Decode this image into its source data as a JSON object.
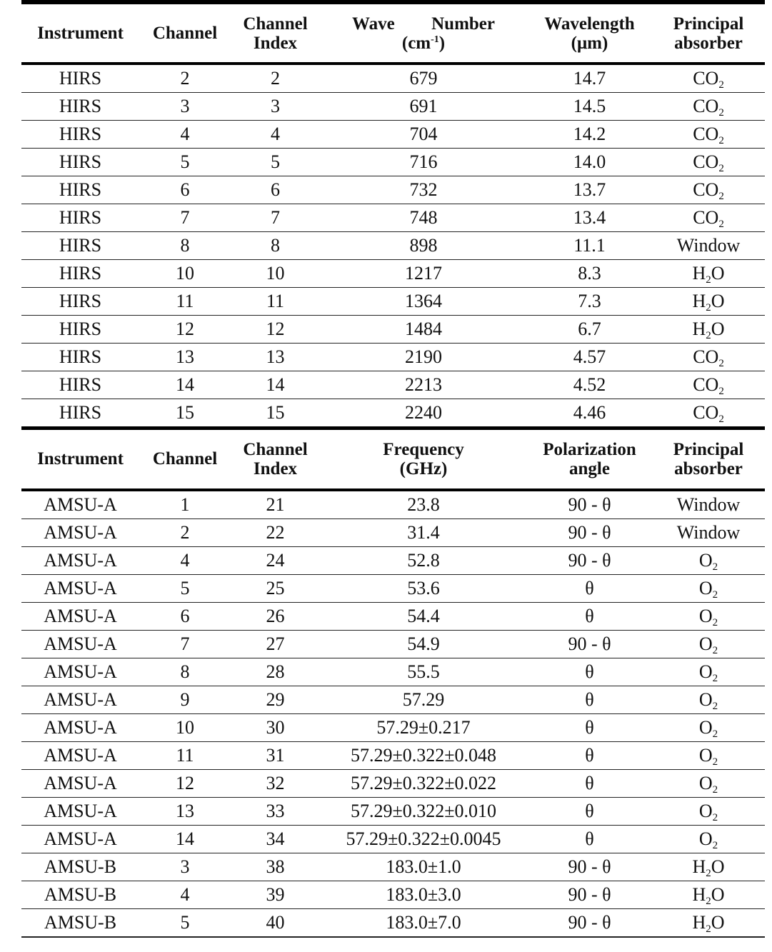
{
  "table1": {
    "headers": {
      "instrument": "Instrument",
      "channel": "Channel",
      "channel_index_1": "Channel",
      "channel_index_2": "Index",
      "wave_number_1a": "Wave",
      "wave_number_1b": "Number",
      "wave_number_2": "(cm",
      "wave_number_sup": "-1",
      "wave_number_3": ")",
      "wavelength_1": "Wavelength",
      "wavelength_2": "(μm)",
      "absorber_1": "Principal",
      "absorber_2": "absorber"
    },
    "rows": [
      {
        "instrument": "HIRS",
        "channel": "2",
        "index": "2",
        "value": "679",
        "wavelength": "14.7",
        "absorber": "CO",
        "sub": "2",
        "tail": ""
      },
      {
        "instrument": "HIRS",
        "channel": "3",
        "index": "3",
        "value": "691",
        "wavelength": "14.5",
        "absorber": "CO",
        "sub": "2",
        "tail": ""
      },
      {
        "instrument": "HIRS",
        "channel": "4",
        "index": "4",
        "value": "704",
        "wavelength": "14.2",
        "absorber": "CO",
        "sub": "2",
        "tail": ""
      },
      {
        "instrument": "HIRS",
        "channel": "5",
        "index": "5",
        "value": "716",
        "wavelength": "14.0",
        "absorber": "CO",
        "sub": "2",
        "tail": ""
      },
      {
        "instrument": "HIRS",
        "channel": "6",
        "index": "6",
        "value": "732",
        "wavelength": "13.7",
        "absorber": "CO",
        "sub": "2",
        "tail": ""
      },
      {
        "instrument": "HIRS",
        "channel": "7",
        "index": "7",
        "value": "748",
        "wavelength": "13.4",
        "absorber": "CO",
        "sub": "2",
        "tail": ""
      },
      {
        "instrument": "HIRS",
        "channel": "8",
        "index": "8",
        "value": "898",
        "wavelength": "11.1",
        "absorber": "Window",
        "sub": "",
        "tail": ""
      },
      {
        "instrument": "HIRS",
        "channel": "10",
        "index": "10",
        "value": "1217",
        "wavelength": "8.3",
        "absorber": "H",
        "sub": "2",
        "tail": "O"
      },
      {
        "instrument": "HIRS",
        "channel": "11",
        "index": "11",
        "value": "1364",
        "wavelength": "7.3",
        "absorber": "H",
        "sub": "2",
        "tail": "O"
      },
      {
        "instrument": "HIRS",
        "channel": "12",
        "index": "12",
        "value": "1484",
        "wavelength": "6.7",
        "absorber": "H",
        "sub": "2",
        "tail": "O"
      },
      {
        "instrument": "HIRS",
        "channel": "13",
        "index": "13",
        "value": "2190",
        "wavelength": "4.57",
        "absorber": "CO",
        "sub": "2",
        "tail": ""
      },
      {
        "instrument": "HIRS",
        "channel": "14",
        "index": "14",
        "value": "2213",
        "wavelength": "4.52",
        "absorber": "CO",
        "sub": "2",
        "tail": ""
      },
      {
        "instrument": "HIRS",
        "channel": "15",
        "index": "15",
        "value": "2240",
        "wavelength": "4.46",
        "absorber": "CO",
        "sub": "2",
        "tail": ""
      }
    ]
  },
  "table2": {
    "headers": {
      "instrument": "Instrument",
      "channel": "Channel",
      "channel_index_1": "Channel",
      "channel_index_2": "Index",
      "frequency_1": "Frequency",
      "frequency_2": "(GHz)",
      "polarization_1": "Polarization",
      "polarization_2": "angle",
      "absorber_1": "Principal",
      "absorber_2": "absorber"
    },
    "rows": [
      {
        "instrument": "AMSU-A",
        "channel": "1",
        "index": "21",
        "value": "23.8",
        "polarization": "90  -  θ",
        "absorber": "Window",
        "sub": "",
        "tail": ""
      },
      {
        "instrument": "AMSU-A",
        "channel": "2",
        "index": "22",
        "value": "31.4",
        "polarization": "90  -  θ",
        "absorber": "Window",
        "sub": "",
        "tail": ""
      },
      {
        "instrument": "AMSU-A",
        "channel": "4",
        "index": "24",
        "value": "52.8",
        "polarization": "90  -  θ",
        "absorber": "O",
        "sub": "2",
        "tail": ""
      },
      {
        "instrument": "AMSU-A",
        "channel": "5",
        "index": "25",
        "value": "53.6",
        "polarization": "θ",
        "absorber": "O",
        "sub": "2",
        "tail": ""
      },
      {
        "instrument": "AMSU-A",
        "channel": "6",
        "index": "26",
        "value": "54.4",
        "polarization": "θ",
        "absorber": "O",
        "sub": "2",
        "tail": ""
      },
      {
        "instrument": "AMSU-A",
        "channel": "7",
        "index": "27",
        "value": "54.9",
        "polarization": "90  -  θ",
        "absorber": "O",
        "sub": "2",
        "tail": ""
      },
      {
        "instrument": "AMSU-A",
        "channel": "8",
        "index": "28",
        "value": "55.5",
        "polarization": "θ",
        "absorber": "O",
        "sub": "2",
        "tail": ""
      },
      {
        "instrument": "AMSU-A",
        "channel": "9",
        "index": "29",
        "value": "57.29",
        "polarization": "θ",
        "absorber": "O",
        "sub": "2",
        "tail": ""
      },
      {
        "instrument": "AMSU-A",
        "channel": "10",
        "index": "30",
        "value": "57.29±0.217",
        "polarization": "θ",
        "absorber": "O",
        "sub": "2",
        "tail": ""
      },
      {
        "instrument": "AMSU-A",
        "channel": "11",
        "index": "31",
        "value": "57.29±0.322±0.048",
        "polarization": "θ",
        "absorber": "O",
        "sub": "2",
        "tail": ""
      },
      {
        "instrument": "AMSU-A",
        "channel": "12",
        "index": "32",
        "value": "57.29±0.322±0.022",
        "polarization": "θ",
        "absorber": "O",
        "sub": "2",
        "tail": ""
      },
      {
        "instrument": "AMSU-A",
        "channel": "13",
        "index": "33",
        "value": "57.29±0.322±0.010",
        "polarization": "θ",
        "absorber": "O",
        "sub": "2",
        "tail": ""
      },
      {
        "instrument": "AMSU-A",
        "channel": "14",
        "index": "34",
        "value": "57.29±0.322±0.0045",
        "polarization": "θ",
        "absorber": "O",
        "sub": "2",
        "tail": ""
      },
      {
        "instrument": "AMSU-B",
        "channel": "3",
        "index": "38",
        "value": "183.0±1.0",
        "polarization": "90  -  θ",
        "absorber": "H",
        "sub": "2",
        "tail": "O"
      },
      {
        "instrument": "AMSU-B",
        "channel": "4",
        "index": "39",
        "value": "183.0±3.0",
        "polarization": "90  -  θ",
        "absorber": "H",
        "sub": "2",
        "tail": "O"
      },
      {
        "instrument": "AMSU-B",
        "channel": "5",
        "index": "40",
        "value": "183.0±7.0",
        "polarization": "90  -  θ",
        "absorber": "H",
        "sub": "2",
        "tail": "O"
      }
    ]
  }
}
